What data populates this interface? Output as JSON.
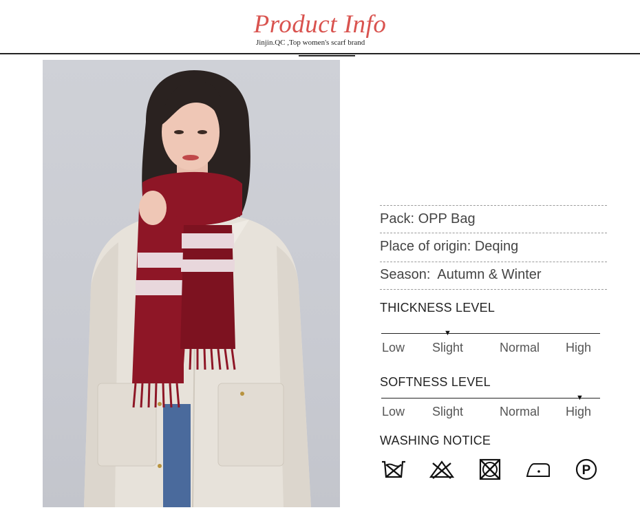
{
  "header": {
    "title": "Product Info",
    "subtitle": "Jinjin.QC ,Top women's scarf brand"
  },
  "product": {
    "pack": "Pack: OPP Bag",
    "origin": "Place of origin: Deqing",
    "season": "Season:  Autumn & Winter"
  },
  "thickness": {
    "title": "THICKNESS LEVEL",
    "labels": [
      "Low",
      "Slight",
      "Normal",
      "High"
    ],
    "selected": "Slight"
  },
  "softness": {
    "title": "SOFTNESS LEVEL",
    "labels": [
      "Low",
      "Slight",
      "Normal",
      "High"
    ],
    "selected": "High"
  },
  "washing": {
    "title": "WASHING NOTICE",
    "icons": [
      "hand-wash-icon",
      "do-not-bleach-icon",
      "do-not-tumble-dry-icon",
      "iron-low-heat-icon",
      "dry-clean-p-icon"
    ]
  },
  "colors": {
    "accent": "#d9534f",
    "scarf": "#8e1626",
    "coat": "#e9e4dc",
    "background": "#cfd1d7"
  }
}
